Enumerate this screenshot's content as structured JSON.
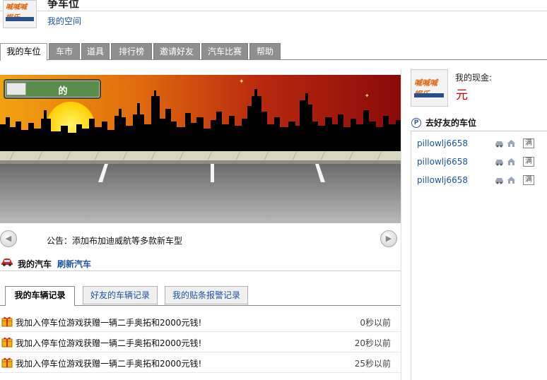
{
  "header": {
    "title": "争车位",
    "my_space": "我的空间",
    "logo_text": "喊喊喊 娱乐"
  },
  "tabs": [
    {
      "label": "我的车位",
      "active": true
    },
    {
      "label": "车市",
      "active": false
    },
    {
      "label": "道具",
      "active": false
    },
    {
      "label": "排行榜",
      "active": false
    },
    {
      "label": "邀请好友",
      "active": false
    },
    {
      "label": "汽车比赛",
      "active": false
    },
    {
      "label": "帮助",
      "active": false
    }
  ],
  "scene": {
    "sign_text": "的"
  },
  "announcement": {
    "text": "公告：添加布加迪威航等多款新车型",
    "prev_icon": "arrow-left-icon",
    "next_icon": "arrow-right-icon"
  },
  "my_car": {
    "label": "我的汽车",
    "refresh": "刷新汽车"
  },
  "record_tabs": [
    {
      "label": "我的车辆记录",
      "active": true
    },
    {
      "label": "好友的车辆记录",
      "active": false
    },
    {
      "label": "我的贴条报警记录",
      "active": false
    }
  ],
  "records": [
    {
      "text": "我加入停车位游戏获赠一辆二手奥拓和2000元钱!",
      "time": "0秒以前"
    },
    {
      "text": "我加入停车位游戏获赠一辆二手奥拓和2000元钱!",
      "time": "20秒以前"
    },
    {
      "text": "我加入停车位游戏获赠一辆二手奥拓和2000元钱!",
      "time": "25秒以前"
    }
  ],
  "side": {
    "cash_label": "我的现金:",
    "cash_value": "元",
    "friends_title": "去好友的车位",
    "friends": [
      {
        "name": "pillowlj6658",
        "badge": "满"
      },
      {
        "name": "pillowlj6658",
        "badge": "满"
      },
      {
        "name": "pillowlj6658",
        "badge": "满"
      }
    ]
  },
  "colors": {
    "accent_link": "#1a55a6",
    "cash": "#d20000",
    "tab_bg": "#8f8f8f",
    "sign_green": "#5a8d4c"
  }
}
